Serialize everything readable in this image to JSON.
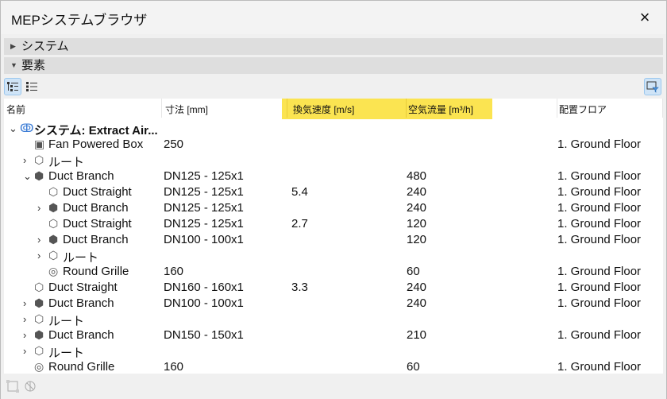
{
  "window": {
    "title": "MEPシステムブラウザ",
    "close_icon": "×"
  },
  "sections": [
    {
      "label": "システム",
      "expanded": false
    },
    {
      "label": "要素",
      "expanded": true
    }
  ],
  "columns": [
    "名前",
    "寸法 [mm]",
    "換気速度 [m/s]",
    "空気流量 [m³/h]",
    "配置フロア"
  ],
  "highlight_color": "#fbe451",
  "rows": [
    {
      "level": 0,
      "chevron": "⌄",
      "icon": "system-icon",
      "name": "システム: Extract Air...",
      "bold": true,
      "size": "",
      "speed": "",
      "flow": "",
      "floor": ""
    },
    {
      "level": 1,
      "chevron": "",
      "icon": "fan-box-icon",
      "name": "Fan Powered Box",
      "size": "250",
      "speed": "",
      "flow": "",
      "floor": "1. Ground Floor"
    },
    {
      "level": 1,
      "chevron": "›",
      "icon": "route-icon",
      "name": "ルート",
      "size": "",
      "speed": "",
      "flow": "",
      "floor": ""
    },
    {
      "level": 1,
      "chevron": "⌄",
      "icon": "duct-branch-icon",
      "name": "Duct Branch",
      "size": "DN125 - 125x1",
      "speed": "",
      "flow": "480",
      "floor": "1. Ground Floor"
    },
    {
      "level": 2,
      "chevron": "",
      "icon": "duct-straight-icon",
      "name": "Duct Straight",
      "size": "DN125 - 125x1",
      "speed": "5.4",
      "flow": "240",
      "floor": "1. Ground Floor"
    },
    {
      "level": 2,
      "chevron": "›",
      "icon": "duct-branch-icon",
      "name": "Duct Branch",
      "size": "DN125 - 125x1",
      "speed": "",
      "flow": "240",
      "floor": "1. Ground Floor"
    },
    {
      "level": 2,
      "chevron": "",
      "icon": "duct-straight-icon",
      "name": "Duct Straight",
      "size": "DN125 - 125x1",
      "speed": "2.7",
      "flow": "120",
      "floor": "1. Ground Floor"
    },
    {
      "level": 2,
      "chevron": "›",
      "icon": "duct-branch-icon",
      "name": "Duct Branch",
      "size": "DN100 - 100x1",
      "speed": "",
      "flow": "120",
      "floor": "1. Ground Floor"
    },
    {
      "level": 2,
      "chevron": "›",
      "icon": "route-icon",
      "name": "ルート",
      "size": "",
      "speed": "",
      "flow": "",
      "floor": ""
    },
    {
      "level": 2,
      "chevron": "",
      "icon": "round-grille-icon",
      "name": "Round Grille",
      "size": "160",
      "speed": "",
      "flow": "60",
      "floor": "1. Ground Floor"
    },
    {
      "level": 1,
      "chevron": "",
      "icon": "duct-straight-icon",
      "name": "Duct Straight",
      "size": "DN160 - 160x1",
      "speed": "3.3",
      "flow": "240",
      "floor": "1. Ground Floor"
    },
    {
      "level": 1,
      "chevron": "›",
      "icon": "duct-branch-icon",
      "name": "Duct Branch",
      "size": "DN100 - 100x1",
      "speed": "",
      "flow": "240",
      "floor": "1. Ground Floor"
    },
    {
      "level": 1,
      "chevron": "›",
      "icon": "route-icon",
      "name": "ルート",
      "size": "",
      "speed": "",
      "flow": "",
      "floor": ""
    },
    {
      "level": 1,
      "chevron": "›",
      "icon": "duct-branch-icon",
      "name": "Duct Branch",
      "size": "DN150 - 150x1",
      "speed": "",
      "flow": "210",
      "floor": "1. Ground Floor"
    },
    {
      "level": 1,
      "chevron": "›",
      "icon": "route-icon",
      "name": "ルート",
      "size": "",
      "speed": "",
      "flow": "",
      "floor": ""
    },
    {
      "level": 1,
      "chevron": "",
      "icon": "round-grille-icon",
      "name": "Round Grille",
      "size": "160",
      "speed": "",
      "flow": "60",
      "floor": "1. Ground Floor"
    }
  ]
}
